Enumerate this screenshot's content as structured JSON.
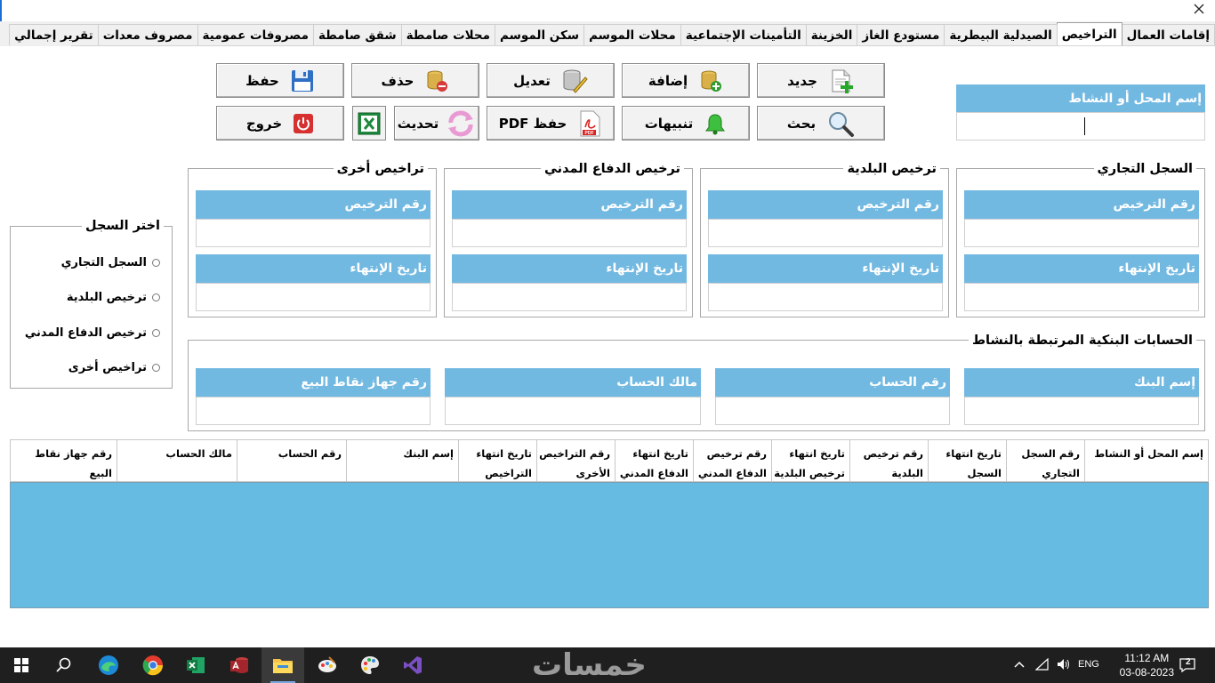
{
  "tabs": [
    "إقامات العمال",
    "التراخيص",
    "الصيدلية البيطرية",
    "مستودع الغاز",
    "الخزينة",
    "التأمينات الإجتماعية",
    "محلات الموسم",
    "سكن الموسم",
    "محلات صامطة",
    "شقق صامطة",
    "مصروفات عمومية",
    "مصروف معدات",
    "تقرير إجمالي"
  ],
  "active_tab": "التراخيص",
  "toolbar": {
    "new": "جديد",
    "add": "إضافة",
    "edit": "تعديل",
    "delete": "حذف",
    "save": "حفظ",
    "search": "بحث",
    "alerts": "تنبيهات",
    "save_pdf": "حفظ PDF",
    "refresh": "تحديث",
    "exit": "خروج",
    "pdf_badge": "PDF"
  },
  "activity_name": {
    "label": "إسم المحل أو النشاط",
    "value": ""
  },
  "groups": {
    "commercial": {
      "title": "السجل التجاري",
      "license_no": "رقم الترخيص",
      "expiry": "تاريخ الإنتهاء"
    },
    "municipal": {
      "title": "ترخيص البلدية",
      "license_no": "رقم الترخيص",
      "expiry": "تاريخ الإنتهاء"
    },
    "civil_defense": {
      "title": "ترخيص الدفاع المدني",
      "license_no": "رقم الترخيص",
      "expiry": "تاريخ الإنتهاء"
    },
    "other": {
      "title": "تراخيص أخرى",
      "license_no": "رقم الترخيص",
      "expiry": "تاريخ الإنتهاء"
    }
  },
  "bank": {
    "title": "الحسابات البنكية المرتبطة بالنشاط",
    "bank_name": "إسم البنك",
    "account_no": "رقم الحساب",
    "account_owner": "مالك الحساب",
    "pos_no": "رقم جهاز نقاط البيع"
  },
  "record_select": {
    "title": "اختر السجل",
    "options": [
      "السجل التجاري",
      "ترخيص البلدية",
      "ترخيص الدفاع المدني",
      "تراخيص أخرى"
    ]
  },
  "grid": {
    "columns": [
      "إسم المحل أو النشاط",
      "رقم السجل التجاري",
      "تاريخ انتهاء السجل التجاري",
      "رقم ترخيص البلدية",
      "تاريخ انتهاء ترخيص البلدية",
      "رقم ترخيص الدفاع المدني",
      "تاريخ انتهاء الدفاع المدني",
      "رقم التراخيص الأخرى",
      "تاريخ انتهاء التراخيص",
      "إسم البنك",
      "رقم الحساب",
      "مالك الحساب",
      "رقم جهاز نقاط البيع"
    ],
    "rows": []
  },
  "taskbar": {
    "apps": [
      "start-icon",
      "search-icon",
      "edge-icon",
      "chrome-icon",
      "excel-icon",
      "access-icon",
      "file-explorer-icon",
      "paint-icon",
      "paint-palette-icon",
      "visual-studio-icon"
    ],
    "watermark": "خمسات",
    "lang": "ENG",
    "time": "11:12 AM",
    "date": "03-08-2023",
    "notifications": "2"
  },
  "colors": {
    "label_bg": "#72b9e2",
    "grid_bg": "#66bbe3",
    "taskbar_bg": "#1f1f1f"
  }
}
